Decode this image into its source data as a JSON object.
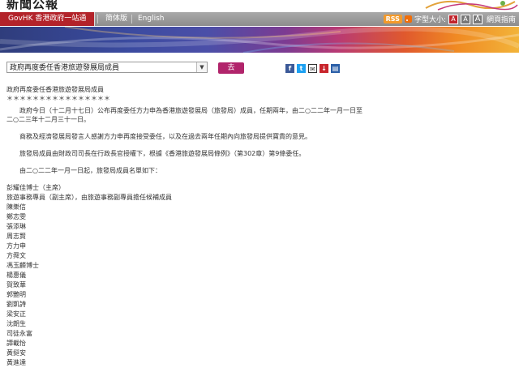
{
  "masthead": {
    "title": "新聞公報"
  },
  "nav": {
    "govhk": "GovHK 香港政府一站通",
    "simplified": "简体版",
    "english": "English",
    "rss": "RSS",
    "font_size_label": "字型大小:",
    "font_a": "A",
    "sitemap": "網頁指南"
  },
  "topic_select": {
    "value": "政府再度委任香港旅遊發展局成員"
  },
  "go_button": "去",
  "article": {
    "title": "政府再度委任香港旅遊發展局成員",
    "stars": "＊＊＊＊＊＊＊＊＊＊＊＊＊＊＊＊",
    "paragraphs": [
      "政府今日（十二月十七日）公布再度委任方力申為香港旅遊發展局（旅發局）成員，任期兩年，由二○二二年一月一日至二○二三年十二月三十一日。",
      "商務及經濟發展局發言人感謝方力申再度接受委任，以及在過去兩年任期內向旅發局提供寶貴的意見。",
      "旅發局成員由財政司司長在行政長官授權下，根據《香港旅遊發展局條例》（第302章）第9條委任。",
      "由二○二二年一月一日起，旅發局成員名單如下："
    ],
    "members": [
      "彭耀佳博士（主席）",
      "旅遊事務專員（副主席），由旅遊事務副專員擔任候補成員",
      "陳樂信",
      "鄭志雯",
      "張添琳",
      "周志賢",
      "方力申",
      "方舜文",
      "馮玉麟博士",
      "楊惠儀",
      "賀致華",
      "郭艷明",
      "劉凱詩",
      "梁安正",
      "沈朗生",
      "司徒永富",
      "譚載怡",
      "黃挺安",
      "黃進達"
    ]
  }
}
